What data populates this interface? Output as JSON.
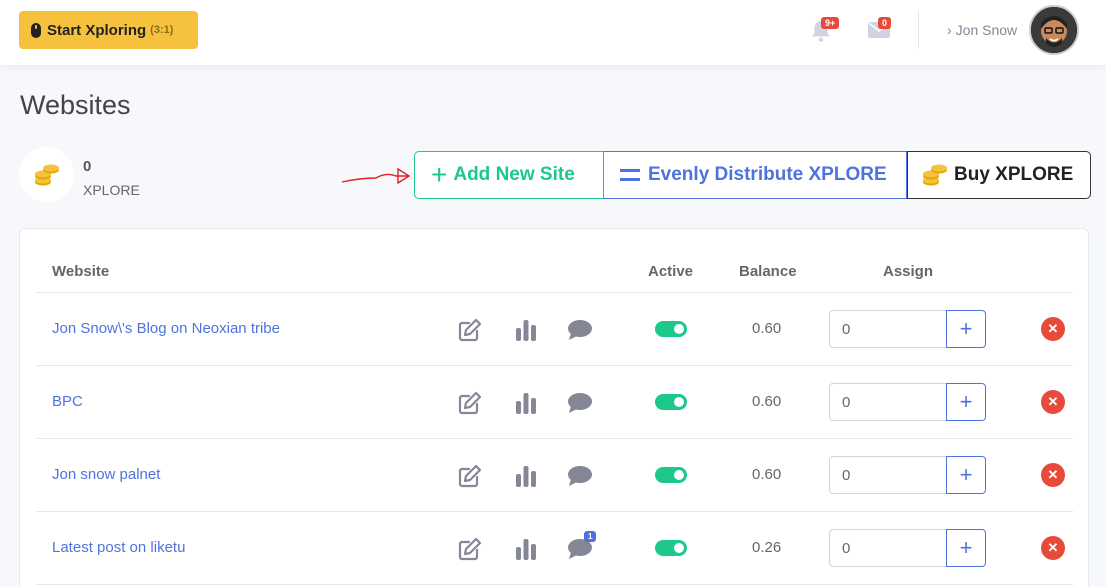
{
  "topbar": {
    "start_label": "Start Xploring",
    "start_ratio": "(3:1)",
    "notifications_badge": "9+",
    "messages_badge": "0",
    "user_name": "Jon Snow"
  },
  "page": {
    "title": "Websites"
  },
  "wallet": {
    "balance": "0",
    "unit": "XPLORE"
  },
  "actions": {
    "add_site_label": "Add New Site",
    "distribute_label": "Evenly Distribute XPLORE",
    "buy_label": "Buy XPLORE"
  },
  "table": {
    "headers": {
      "website": "Website",
      "active": "Active",
      "balance": "Balance",
      "assign": "Assign"
    },
    "rows": [
      {
        "name": "Jon Snow\\'s Blog on Neoxian tribe",
        "balance": "0.60",
        "assign": "0",
        "active": true,
        "chat_badge": ""
      },
      {
        "name": "BPC",
        "balance": "0.60",
        "assign": "0",
        "active": true,
        "chat_badge": ""
      },
      {
        "name": "Jon snow palnet",
        "balance": "0.60",
        "assign": "0",
        "active": true,
        "chat_badge": ""
      },
      {
        "name": "Latest post on liketu",
        "balance": "0.26",
        "assign": "0",
        "active": true,
        "chat_badge": "1"
      }
    ]
  },
  "colors": {
    "primary": "#4e73df",
    "success": "#1cc88a",
    "danger": "#e74a3b",
    "warning": "#f6c23e"
  }
}
